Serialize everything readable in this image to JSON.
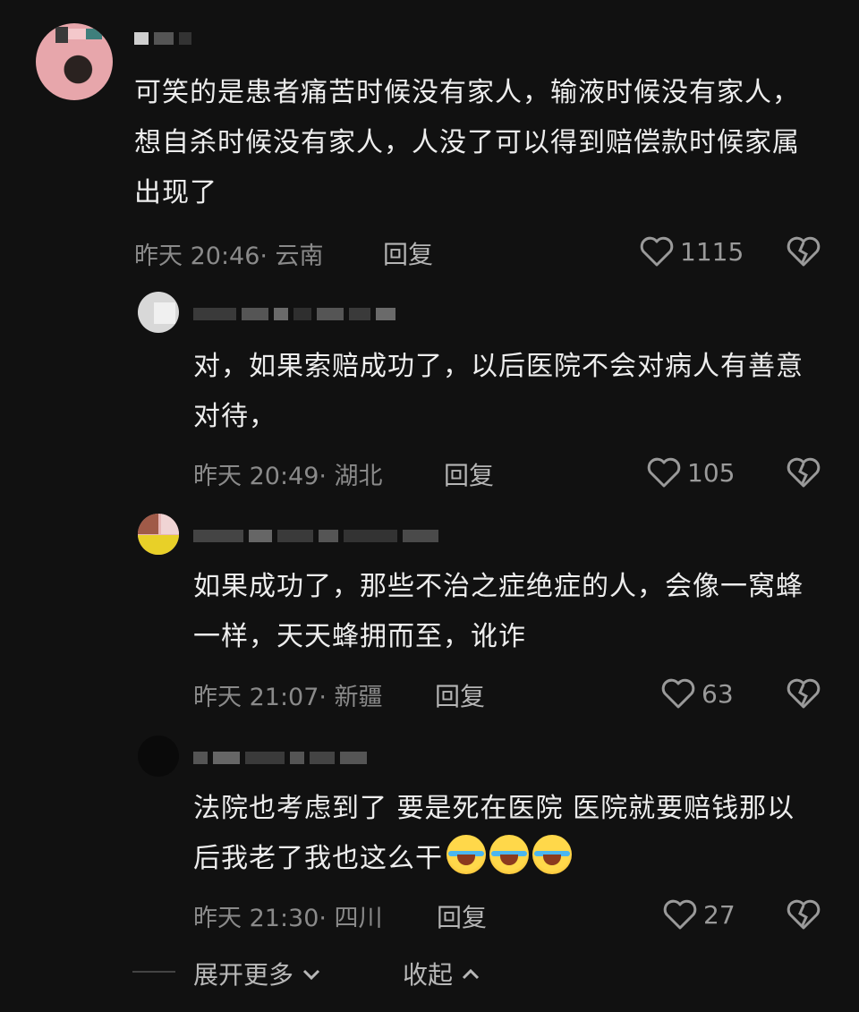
{
  "comments": [
    {
      "text": "可笑的是患者痛苦时候没有家人，输液时候没有家人，想自杀时候没有家人，人没了可以得到赔偿款时候家属出现了",
      "meta": "昨天 20:46· 云南",
      "reply_label": "回复",
      "likes": "1115"
    },
    {
      "text": "对，如果索赔成功了，以后医院不会对病人有善意对待，",
      "meta": "昨天 20:49· 湖北",
      "reply_label": "回复",
      "likes": "105"
    },
    {
      "text": "如果成功了，那些不治之症绝症的人，会像一窝蜂一样，天天蜂拥而至，讹诈",
      "meta": "昨天 21:07· 新疆",
      "reply_label": "回复",
      "likes": "63"
    },
    {
      "text": "法院也考虑到了 要是死在医院 医院就要赔钱那以后我老了我也这么干",
      "meta": "昨天 21:30· 四川",
      "reply_label": "回复",
      "likes": "27"
    }
  ],
  "footer": {
    "expand_label": "展开更多",
    "collapse_label": "收起"
  },
  "icons": {
    "like": "heart-icon",
    "dislike": "broken-heart-icon",
    "emoji": "laugh-cry-emoji-icon"
  },
  "colors": {
    "background": "#111111",
    "text": "#ededed",
    "meta": "#8a8a8a"
  }
}
